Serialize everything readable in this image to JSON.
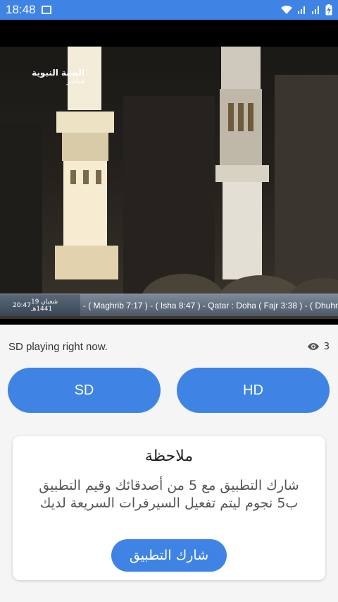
{
  "status_bar": {
    "time": "18:48",
    "icons": [
      "gallery-icon",
      "wifi-icon",
      "signal-icon",
      "signal-icon",
      "battery-charging-icon"
    ]
  },
  "video": {
    "channel_name": "السنة النبوية",
    "live_label": "مباشر",
    "ticker_time": "20:47",
    "ticker_date": "19 شعبان 1441هـ",
    "ticker_text": "- ( Maghrib 7:17 ) - ( Isha 8:47 ) - Qatar : Doha  ( Fajr 3:38 ) - ( Dhuhr"
  },
  "status": {
    "text": "SD playing right now.",
    "viewer_count": "3",
    "viewer_icon": "eye-icon"
  },
  "buttons": {
    "sd": "SD",
    "hd": "HD"
  },
  "note": {
    "title": "ملاحظة",
    "body": "شارك التطبيق مع 5 من أصدقائك وقيم التطبيق ب5 نجوم ليتم تفعيل السيرفرات السريعة لديك",
    "share_label": "شارك التطبيق"
  },
  "colors": {
    "accent": "#3f84e5",
    "background": "#f5f5f5",
    "card": "#ffffff"
  }
}
